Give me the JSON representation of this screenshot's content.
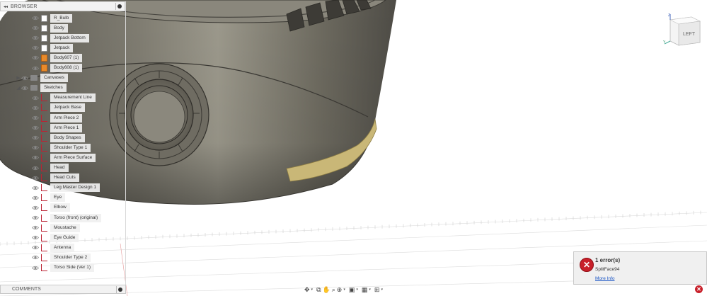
{
  "browser": {
    "title": "BROWSER",
    "collapse_glyph": "◂◂",
    "items": [
      {
        "label": "R_Bulb",
        "icon": "body-icon"
      },
      {
        "label": "Body",
        "icon": "body-icon"
      },
      {
        "label": "Jetpack Bottom",
        "icon": "body-icon"
      },
      {
        "label": "Jetpack",
        "icon": "body-icon"
      },
      {
        "label": "Body607 (1)",
        "icon": "body-link-icon"
      },
      {
        "label": "Body608 (1)",
        "icon": "body-link-icon"
      },
      {
        "label": "Canvases",
        "icon": "folder-icon",
        "expander": "▶"
      },
      {
        "label": "Sketches",
        "icon": "folder-icon",
        "expander": "◢"
      },
      {
        "label": "Measurement Line",
        "icon": "sketch-icon"
      },
      {
        "label": "Jetpack Base",
        "icon": "sketch-icon"
      },
      {
        "label": "Arm Piece 2",
        "icon": "sketch-icon"
      },
      {
        "label": "Arm Piece 1",
        "icon": "sketch-icon"
      },
      {
        "label": "Body Shapes",
        "icon": "sketch-icon"
      },
      {
        "label": "Shoulder Type 1",
        "icon": "sketch-icon"
      },
      {
        "label": "Arm Piece Surface",
        "icon": "sketch-icon"
      },
      {
        "label": "Head",
        "icon": "sketch-icon"
      },
      {
        "label": "Head Cuts",
        "icon": "sketch-icon"
      },
      {
        "label": "Leg Master Design 1",
        "icon": "sketch-icon"
      },
      {
        "label": "Eye",
        "icon": "sketch-icon"
      },
      {
        "label": "Elbow",
        "icon": "sketch-icon"
      },
      {
        "label": "Torso (front) (original)",
        "icon": "sketch-icon"
      },
      {
        "label": "Moustache",
        "icon": "sketch-icon"
      },
      {
        "label": "Eye Guide",
        "icon": "sketch-icon"
      },
      {
        "label": "Antenna",
        "icon": "sketch-icon"
      },
      {
        "label": "Shoulder Type 2",
        "icon": "sketch-icon"
      },
      {
        "label": "Torso Side (Ver 1)",
        "icon": "sketch-icon"
      }
    ]
  },
  "comments": {
    "title": "COMMENTS"
  },
  "viewcube": {
    "face_label": "LEFT",
    "axis_y": "Y",
    "axis_z": "Z"
  },
  "error_toast": {
    "title": "1 error(s)",
    "message": "SplitFace94",
    "link": "More Info",
    "close_glyph": "✕"
  },
  "nav_toolbar": {
    "icons": [
      "orbit-icon",
      "look-at-icon",
      "pan-icon",
      "zoom-icon",
      "fit-icon",
      "display-settings-icon",
      "grid-icon",
      "viewports-icon"
    ]
  },
  "colors": {
    "model_body": "#6e6a5f",
    "model_highlight": "#a7a497",
    "model_accent": "#c9b777",
    "error_red": "#c8202a",
    "grid_line": "#d9d9d9"
  }
}
